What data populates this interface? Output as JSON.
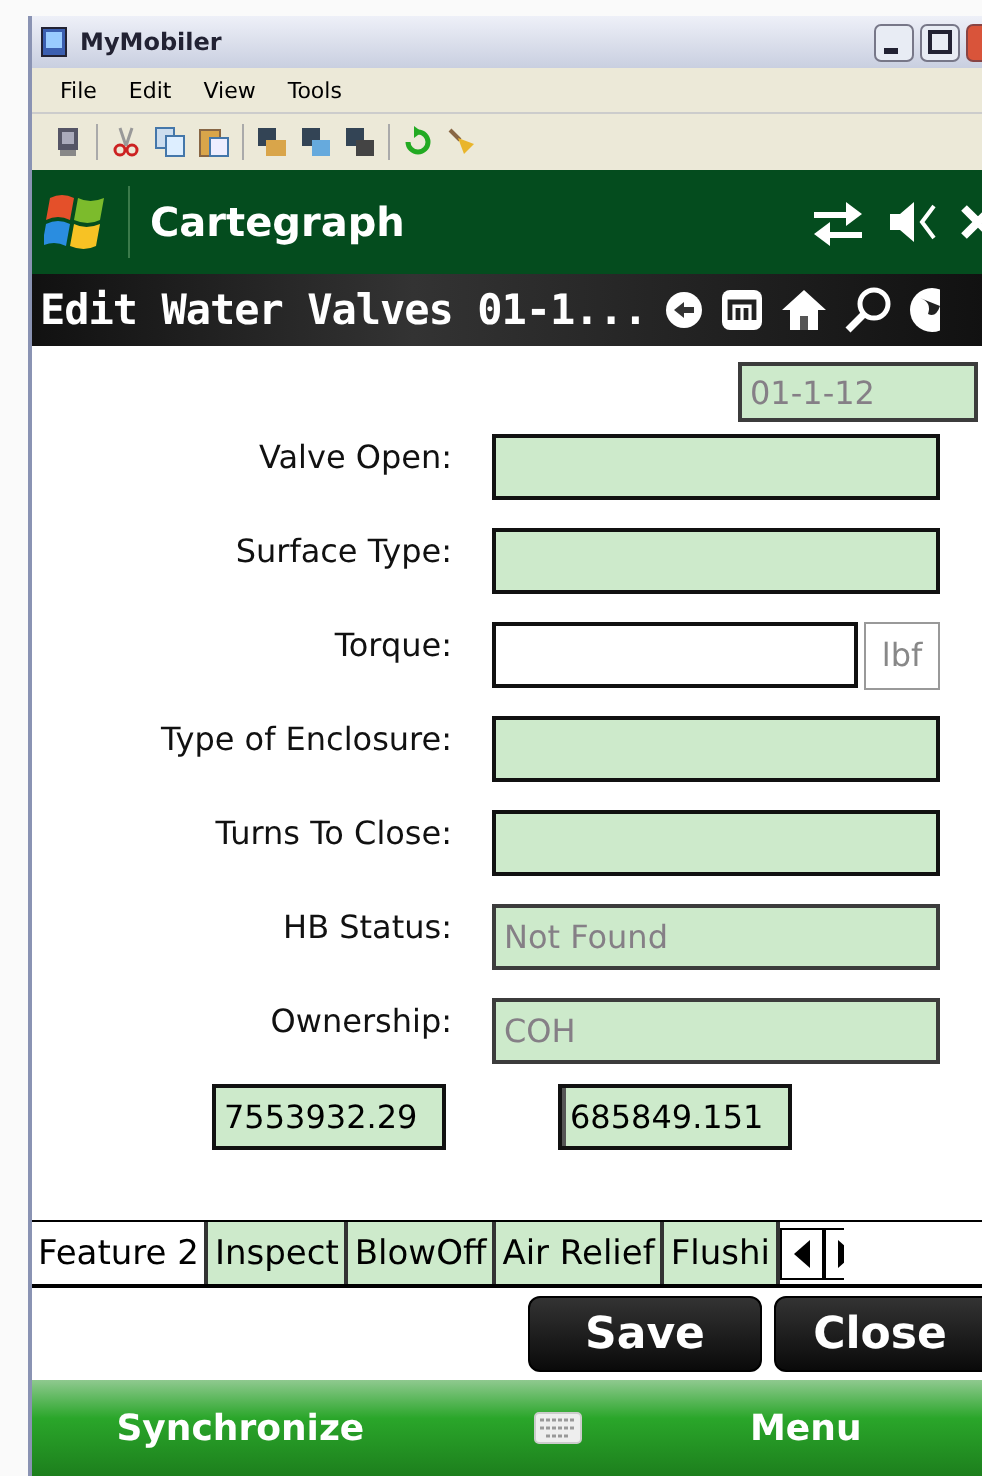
{
  "window": {
    "title": "MyMobiler"
  },
  "menu": [
    "File",
    "Edit",
    "View",
    "Tools"
  ],
  "app_header": {
    "title": "Cartegraph"
  },
  "page_title": "Edit Water Valves 01-1...",
  "id_field": {
    "value": "01-1-12",
    "highlighted": true,
    "disabled": true
  },
  "fields": [
    {
      "label": "Valve Open:",
      "highlighted": true,
      "disabled": false
    },
    {
      "label": "Surface Type:",
      "highlighted": true,
      "disabled": false
    },
    {
      "label": "Torque:",
      "highlighted": false,
      "disabled": false,
      "unit": "lbf"
    },
    {
      "label": "Type of Enclosure:",
      "highlighted": true,
      "disabled": false
    },
    {
      "label": "Turns To Close:",
      "highlighted": true,
      "disabled": false
    },
    {
      "label": "HB Status:",
      "value": "Not Found",
      "highlighted": true,
      "disabled": true
    },
    {
      "label": "Ownership:",
      "value": "COH",
      "highlighted": true,
      "disabled": true
    }
  ],
  "coordinates": [
    {
      "value": "7553932.29",
      "focused": false
    },
    {
      "value": "685849.151",
      "focused": true
    }
  ],
  "tabs": [
    {
      "label": "Feature 2",
      "selected": true
    },
    {
      "label": "Inspect",
      "selected": false
    },
    {
      "label": "BlowOff",
      "selected": false
    },
    {
      "label": "Air Relief",
      "selected": false
    },
    {
      "label": "Flushi",
      "selected": false
    }
  ],
  "buttons": [
    "Save",
    "Close"
  ],
  "softkeys": [
    "Synchronize",
    "Menu"
  ]
}
